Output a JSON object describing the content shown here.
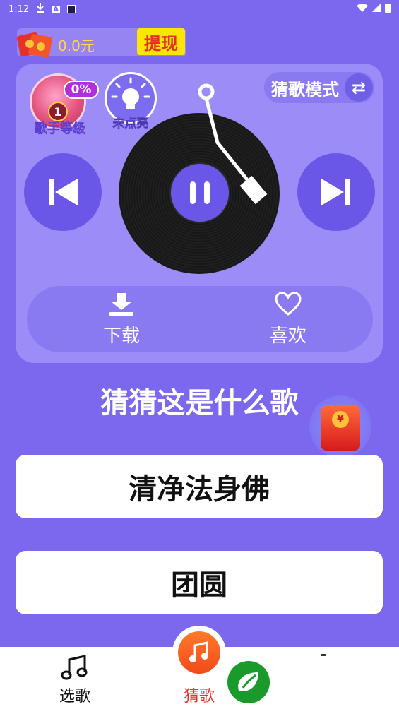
{
  "status_bar": {
    "time": "1:12",
    "download_icon": "download-icon",
    "a_icon": "A"
  },
  "balance": {
    "amount": "0.0元",
    "withdraw_label": "提现"
  },
  "level": {
    "percent": "0%",
    "number": "1",
    "label": "歌手等级"
  },
  "hint": {
    "label": "未点亮"
  },
  "mode": {
    "label": "猜歌模式",
    "swap_icon": "⇄"
  },
  "player": {
    "state": "playing"
  },
  "actions": {
    "download_label": "下载",
    "like_label": "喜欢"
  },
  "question": "猜猜这是什么歌",
  "redpack": {
    "coin": "¥"
  },
  "answers": [
    "清净法身佛",
    "团圆"
  ],
  "bottom_nav": {
    "select_label": "选歌",
    "guess_label": "猜歌"
  },
  "colors": {
    "background": "#7b68ee",
    "card": "#9b8cf7",
    "accent": "#6a57e8",
    "withdraw_bg": "#ffe600",
    "withdraw_text": "#e4322b",
    "balance_text": "#ffd84d"
  }
}
